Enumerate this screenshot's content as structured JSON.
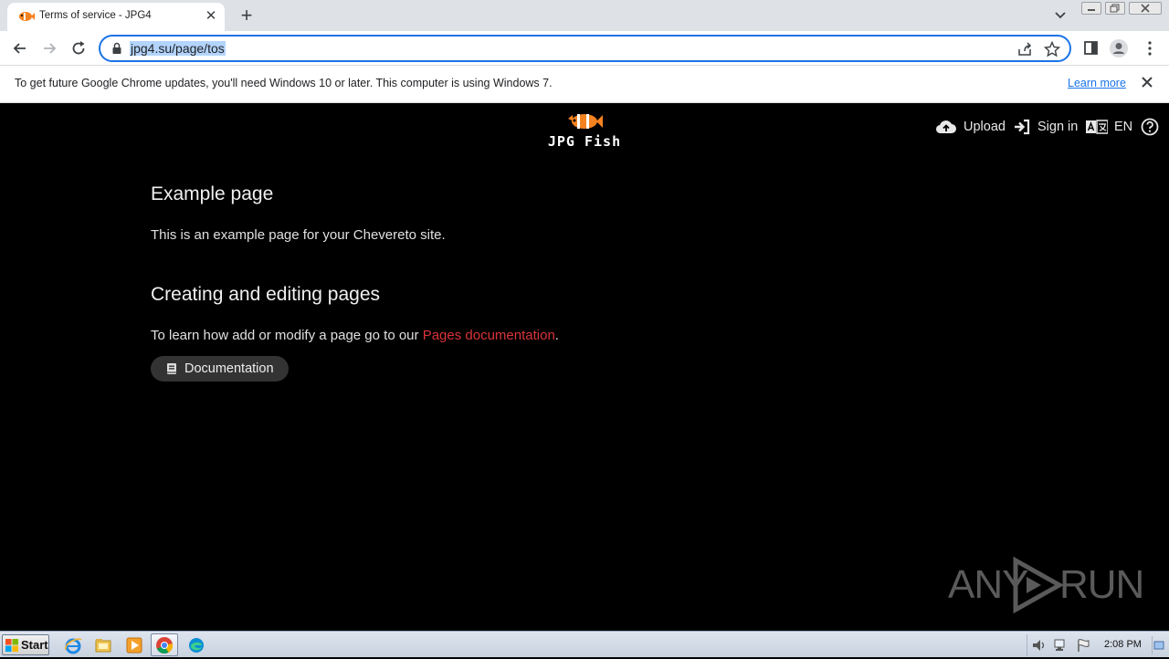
{
  "browser": {
    "tab": {
      "title": "Terms of service - JPG4"
    },
    "url": "jpg4.su/page/tos"
  },
  "infobar": {
    "message": "To get future Google Chrome updates, you'll need Windows 10 or later. This computer is using Windows 7.",
    "learn_more": "Learn more"
  },
  "site": {
    "logo_text": "JPG Fish",
    "nav": {
      "upload": "Upload",
      "sign_in": "Sign in",
      "language": "EN"
    },
    "content": {
      "heading1": "Example page",
      "para1": "This is an example page for your Chevereto site.",
      "heading2": "Creating and editing pages",
      "para2_before": "To learn how add or modify a page go to our ",
      "para2_link": "Pages documentation",
      "para2_after": ".",
      "doc_button": "Documentation"
    }
  },
  "watermark": {
    "left": "ANY",
    "right": "RUN"
  },
  "taskbar": {
    "start_label": "Start",
    "clock": "2:08 PM"
  },
  "colors": {
    "accent": "#1a73e8",
    "page_bg": "#000000",
    "link_red": "#d9343a",
    "logo_orange": "#f58220"
  }
}
